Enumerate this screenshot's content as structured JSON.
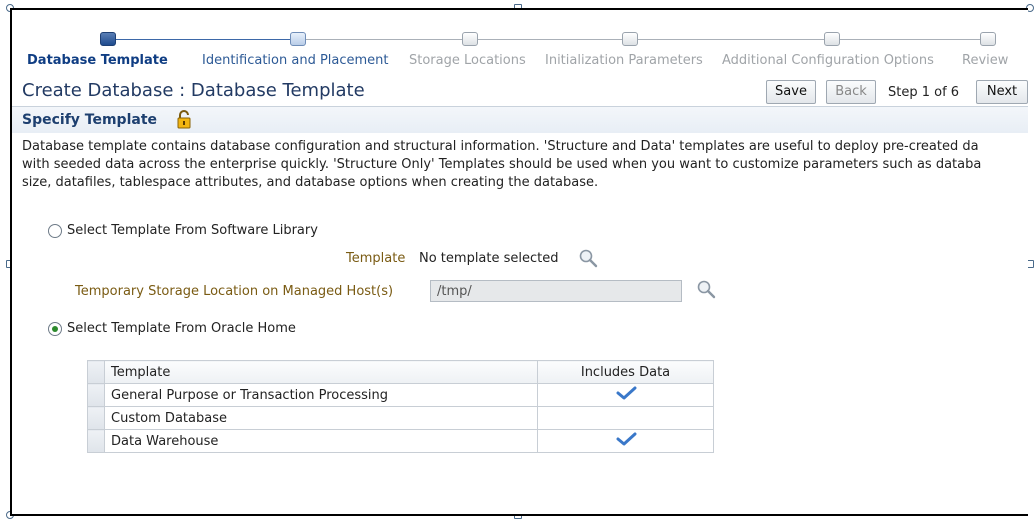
{
  "train": {
    "steps": [
      {
        "label": "Database Template",
        "state": "current"
      },
      {
        "label": "Identification and Placement",
        "state": "visited"
      },
      {
        "label": "Storage Locations",
        "state": "pending"
      },
      {
        "label": "Initialization Parameters",
        "state": "pending"
      },
      {
        "label": "Additional Configuration Options",
        "state": "pending"
      },
      {
        "label": "Review",
        "state": "pending"
      }
    ]
  },
  "header": {
    "title": "Create Database : Database Template",
    "save_label": "Save",
    "back_label": "Back",
    "step_text": "Step 1 of 6",
    "next_label": "Next"
  },
  "section": {
    "title": "Specify Template",
    "description_lines": [
      "Database template contains database configuration and structural information. 'Structure and Data' templates are useful to deploy pre-created da",
      "with seeded data across the enterprise quickly. 'Structure Only' Templates should be used when you want to customize parameters such as databa",
      "size, datafiles, tablespace attributes, and database options when creating the database."
    ]
  },
  "options": {
    "software_library": {
      "label": "Select Template From Software Library",
      "selected": false,
      "template_label": "Template",
      "template_value": "No template selected",
      "temp_storage_label": "Temporary Storage Location on Managed Host(s)",
      "temp_storage_value": "/tmp/"
    },
    "oracle_home": {
      "label": "Select Template From Oracle Home",
      "selected": true
    }
  },
  "table": {
    "headers": [
      "Template",
      "Includes Data"
    ],
    "rows": [
      {
        "template": "General Purpose or Transaction Processing",
        "includes_data": true
      },
      {
        "template": "Custom Database",
        "includes_data": false
      },
      {
        "template": "Data Warehouse",
        "includes_data": true
      }
    ]
  },
  "colors": {
    "accent": "#0f3d83",
    "label_gold": "#7a5b13",
    "check_blue": "#3a78c9"
  },
  "icons": {
    "lock": "lock-icon",
    "search": "search-icon",
    "check": "check-icon"
  }
}
